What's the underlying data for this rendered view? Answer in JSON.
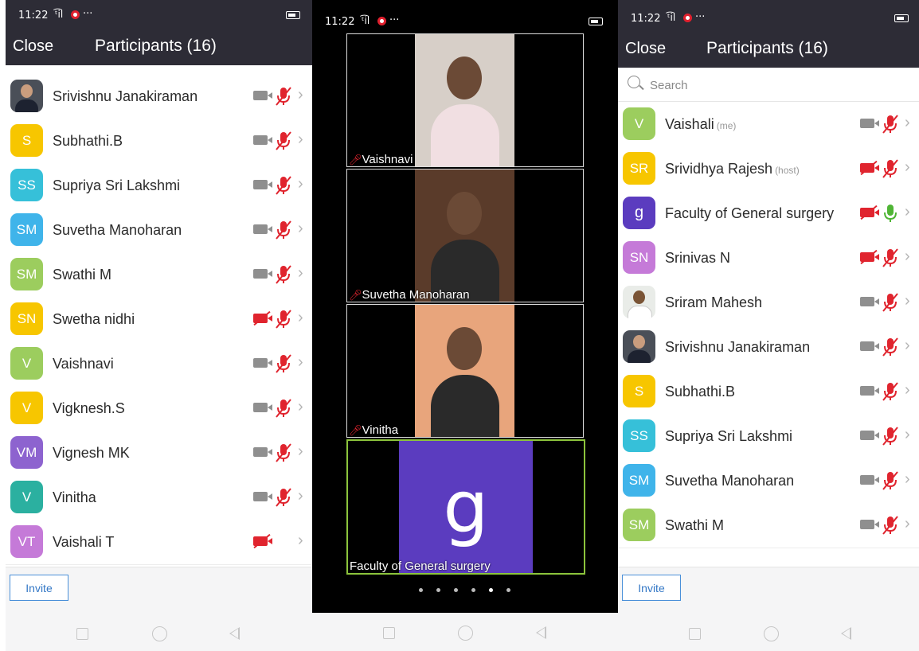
{
  "colors": {
    "header": "#2d2c36",
    "mic_muted": "#e0242e",
    "mic_active": "#4fb535",
    "active_border": "#8cc43c",
    "invite": "#3478c6"
  },
  "status": {
    "time": "11:22",
    "signal": "ᵗ͡il"
  },
  "left": {
    "close_label": "Close",
    "title": "Participants (16)",
    "participants": [
      {
        "name": "Srivishnu Janakiraman",
        "initials": "",
        "color": "",
        "photo": true,
        "video": "on",
        "mic": "muted"
      },
      {
        "name": "Subhathi.B",
        "initials": "S",
        "color": "#f7c600",
        "video": "on",
        "mic": "muted"
      },
      {
        "name": "Supriya Sri Lakshmi",
        "initials": "SS",
        "color": "#36c0d9",
        "video": "on",
        "mic": "muted"
      },
      {
        "name": "Suvetha Manoharan",
        "initials": "SM",
        "color": "#3fb4ea",
        "video": "on",
        "mic": "muted"
      },
      {
        "name": "Swathi M",
        "initials": "SM",
        "color": "#9ccd5e",
        "video": "on",
        "mic": "muted"
      },
      {
        "name": "Swetha nidhi",
        "initials": "SN",
        "color": "#f7c600",
        "video": "off",
        "mic": "muted"
      },
      {
        "name": "Vaishnavi",
        "initials": "V",
        "color": "#9ccd5e",
        "video": "on",
        "mic": "muted"
      },
      {
        "name": "Vigknesh.S",
        "initials": "V",
        "color": "#f7c600",
        "video": "on",
        "mic": "muted"
      },
      {
        "name": "Vignesh MK",
        "initials": "VM",
        "color": "#8d63cf",
        "video": "on",
        "mic": "muted"
      },
      {
        "name": "Vinitha",
        "initials": "V",
        "color": "#2bb0a0",
        "video": "on",
        "mic": "muted"
      },
      {
        "name": "Vaishali T",
        "initials": "VT",
        "color": "#c57ad8",
        "video": "off",
        "mic": "none"
      }
    ],
    "invite_label": "Invite"
  },
  "middle": {
    "tiles": [
      {
        "name": "Vaishnavi",
        "bg": "#d7cfc8",
        "active": false
      },
      {
        "name": "Suvetha Manoharan",
        "bg": "#5a3b2a",
        "active": false
      },
      {
        "name": "Vinitha",
        "bg": "#e8a57c",
        "active": false
      },
      {
        "name": "Faculty of General surgery",
        "bg": "#5b3cbf",
        "letter": "g",
        "active": true
      }
    ],
    "dots": 6,
    "active_dot": 4
  },
  "right": {
    "close_label": "Close",
    "title": "Participants (16)",
    "search_placeholder": "Search",
    "participants": [
      {
        "name": "Vaishali",
        "tag": "(me)",
        "initials": "V",
        "color": "#9ccd5e",
        "video": "on",
        "mic": "muted"
      },
      {
        "name": "Srividhya Rajesh",
        "tag": "(host)",
        "initials": "SR",
        "color": "#f7c600",
        "video": "off",
        "mic": "muted"
      },
      {
        "name": "Faculty of General surgery",
        "tag": "",
        "initials": "g",
        "color": "#5b3cbf",
        "video": "off",
        "mic": "active"
      },
      {
        "name": "Srinivas N",
        "tag": "",
        "initials": "SN",
        "color": "#c57ad8",
        "video": "off",
        "mic": "muted"
      },
      {
        "name": "Sriram Mahesh",
        "tag": "",
        "initials": "",
        "photo": "light",
        "video": "on",
        "mic": "muted"
      },
      {
        "name": "Srivishnu Janakiraman",
        "tag": "",
        "initials": "",
        "photo": true,
        "video": "on",
        "mic": "muted"
      },
      {
        "name": "Subhathi.B",
        "tag": "",
        "initials": "S",
        "color": "#f7c600",
        "video": "on",
        "mic": "muted"
      },
      {
        "name": "Supriya Sri Lakshmi",
        "tag": "",
        "initials": "SS",
        "color": "#36c0d9",
        "video": "on",
        "mic": "muted"
      },
      {
        "name": "Suvetha Manoharan",
        "tag": "",
        "initials": "SM",
        "color": "#3fb4ea",
        "video": "on",
        "mic": "muted"
      },
      {
        "name": "Swathi M",
        "tag": "",
        "initials": "SM",
        "color": "#9ccd5e",
        "video": "on",
        "mic": "muted"
      }
    ],
    "invite_label": "Invite"
  }
}
